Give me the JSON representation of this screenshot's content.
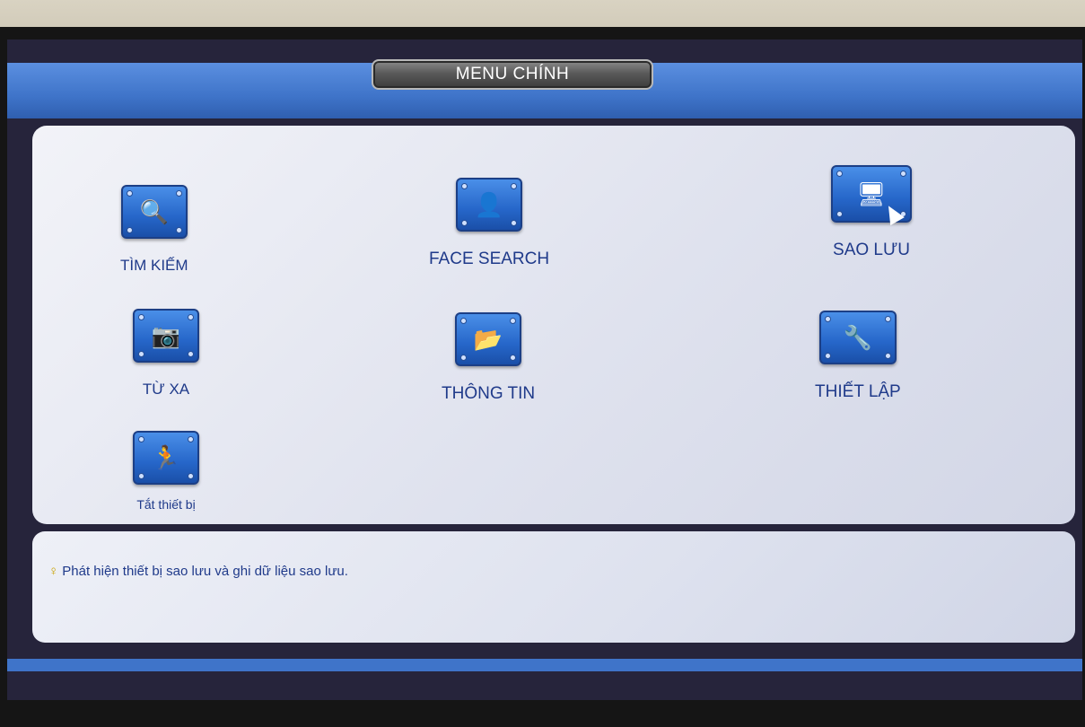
{
  "header": {
    "title": "MENU CHÍNH"
  },
  "menu": {
    "items": [
      {
        "label": "TÌM KIẾM",
        "icon": "search-icon",
        "glyph": "🔍"
      },
      {
        "label": "FACE SEARCH",
        "icon": "face-search-icon",
        "glyph": "👤"
      },
      {
        "label": "SAO LƯU",
        "icon": "backup-icon",
        "glyph": "🖥"
      },
      {
        "label": "TỪ XA",
        "icon": "remote-camera-icon",
        "glyph": "📷"
      },
      {
        "label": "THÔNG TIN",
        "icon": "info-folder-icon",
        "glyph": "📂"
      },
      {
        "label": "THIẾT LẬP",
        "icon": "settings-icon",
        "glyph": "🔧"
      },
      {
        "label": "Tắt thiết bị",
        "icon": "shutdown-icon",
        "glyph": "🏃"
      }
    ]
  },
  "info": {
    "hint": "Phát hiện thiết bị sao lưu và ghi dữ liệu sao lưu.",
    "hint_icon": "lightbulb-icon"
  },
  "colors": {
    "accent": "#3f74c9",
    "label": "#1f3a8a",
    "panel": "#e2e5f0"
  }
}
